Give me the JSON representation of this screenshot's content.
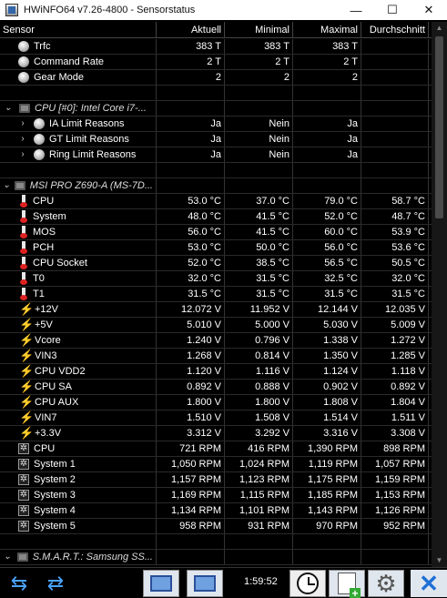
{
  "window": {
    "title": "HWiNFO64 v7.26-4800 - Sensorstatus",
    "minimize": "—",
    "maximize": "☐",
    "close": "✕"
  },
  "header": {
    "sensor": "Sensor",
    "current": "Aktuell",
    "min": "Minimal",
    "max": "Maximal",
    "avg": "Durchschnitt"
  },
  "rows": [
    {
      "type": "item",
      "icon": "circle-icon",
      "label": "Trfc",
      "cur": "383 T",
      "min": "383 T",
      "max": "383 T",
      "avg": ""
    },
    {
      "type": "item",
      "icon": "circle-icon",
      "label": "Command Rate",
      "cur": "2 T",
      "min": "2 T",
      "max": "2 T",
      "avg": ""
    },
    {
      "type": "item",
      "icon": "circle-icon",
      "label": "Gear Mode",
      "cur": "2",
      "min": "2",
      "max": "2",
      "avg": ""
    },
    {
      "type": "blank"
    },
    {
      "type": "group",
      "icon": "chip-icon",
      "label": "CPU [#0]: Intel Core i7-..."
    },
    {
      "type": "subgroup",
      "icon": "circle-icon",
      "label": "IA Limit Reasons",
      "cur": "Ja",
      "min": "Nein",
      "max": "Ja",
      "avg": ""
    },
    {
      "type": "subgroup",
      "icon": "circle-icon",
      "label": "GT Limit Reasons",
      "cur": "Ja",
      "min": "Nein",
      "max": "Ja",
      "avg": ""
    },
    {
      "type": "subgroup",
      "icon": "circle-icon",
      "label": "Ring Limit Reasons",
      "cur": "Ja",
      "min": "Nein",
      "max": "Ja",
      "avg": ""
    },
    {
      "type": "blank"
    },
    {
      "type": "group",
      "icon": "chip-icon",
      "label": "MSI PRO Z690-A (MS-7D..."
    },
    {
      "type": "item",
      "icon": "thermometer-icon",
      "label": "CPU",
      "cur": "53.0 °C",
      "min": "37.0 °C",
      "max": "79.0 °C",
      "avg": "58.7 °C"
    },
    {
      "type": "item",
      "icon": "thermometer-icon",
      "label": "System",
      "cur": "48.0 °C",
      "min": "41.5 °C",
      "max": "52.0 °C",
      "avg": "48.7 °C"
    },
    {
      "type": "item",
      "icon": "thermometer-icon",
      "label": "MOS",
      "cur": "56.0 °C",
      "min": "41.5 °C",
      "max": "60.0 °C",
      "avg": "53.9 °C"
    },
    {
      "type": "item",
      "icon": "thermometer-icon",
      "label": "PCH",
      "cur": "53.0 °C",
      "min": "50.0 °C",
      "max": "56.0 °C",
      "avg": "53.6 °C"
    },
    {
      "type": "item",
      "icon": "thermometer-icon",
      "label": "CPU Socket",
      "cur": "52.0 °C",
      "min": "38.5 °C",
      "max": "56.5 °C",
      "avg": "50.5 °C"
    },
    {
      "type": "item",
      "icon": "thermometer-icon",
      "label": "T0",
      "cur": "32.0 °C",
      "min": "31.5 °C",
      "max": "32.5 °C",
      "avg": "32.0 °C"
    },
    {
      "type": "item",
      "icon": "thermometer-icon",
      "label": "T1",
      "cur": "31.5 °C",
      "min": "31.5 °C",
      "max": "31.5 °C",
      "avg": "31.5 °C"
    },
    {
      "type": "item",
      "icon": "lightning-icon",
      "label": "+12V",
      "cur": "12.072 V",
      "min": "11.952 V",
      "max": "12.144 V",
      "avg": "12.035 V"
    },
    {
      "type": "item",
      "icon": "lightning-icon",
      "label": "+5V",
      "cur": "5.010 V",
      "min": "5.000 V",
      "max": "5.030 V",
      "avg": "5.009 V"
    },
    {
      "type": "item",
      "icon": "lightning-icon",
      "label": "Vcore",
      "cur": "1.240 V",
      "min": "0.796 V",
      "max": "1.338 V",
      "avg": "1.272 V"
    },
    {
      "type": "item",
      "icon": "lightning-icon",
      "label": "VIN3",
      "cur": "1.268 V",
      "min": "0.814 V",
      "max": "1.350 V",
      "avg": "1.285 V"
    },
    {
      "type": "item",
      "icon": "lightning-icon",
      "label": "CPU VDD2",
      "cur": "1.120 V",
      "min": "1.116 V",
      "max": "1.124 V",
      "avg": "1.118 V"
    },
    {
      "type": "item",
      "icon": "lightning-icon",
      "label": "CPU SA",
      "cur": "0.892 V",
      "min": "0.888 V",
      "max": "0.902 V",
      "avg": "0.892 V"
    },
    {
      "type": "item",
      "icon": "lightning-icon",
      "label": "CPU AUX",
      "cur": "1.800 V",
      "min": "1.800 V",
      "max": "1.808 V",
      "avg": "1.804 V"
    },
    {
      "type": "item",
      "icon": "lightning-icon",
      "label": "VIN7",
      "cur": "1.510 V",
      "min": "1.508 V",
      "max": "1.514 V",
      "avg": "1.511 V"
    },
    {
      "type": "item",
      "icon": "lightning-icon",
      "label": "+3.3V",
      "cur": "3.312 V",
      "min": "3.292 V",
      "max": "3.316 V",
      "avg": "3.308 V"
    },
    {
      "type": "item",
      "icon": "fan-icon",
      "label": "CPU",
      "cur": "721 RPM",
      "min": "416 RPM",
      "max": "1,390 RPM",
      "avg": "898 RPM"
    },
    {
      "type": "item",
      "icon": "fan-icon",
      "label": "System 1",
      "cur": "1,050 RPM",
      "min": "1,024 RPM",
      "max": "1,119 RPM",
      "avg": "1,057 RPM"
    },
    {
      "type": "item",
      "icon": "fan-icon",
      "label": "System 2",
      "cur": "1,157 RPM",
      "min": "1,123 RPM",
      "max": "1,175 RPM",
      "avg": "1,159 RPM"
    },
    {
      "type": "item",
      "icon": "fan-icon",
      "label": "System 3",
      "cur": "1,169 RPM",
      "min": "1,115 RPM",
      "max": "1,185 RPM",
      "avg": "1,153 RPM"
    },
    {
      "type": "item",
      "icon": "fan-icon",
      "label": "System 4",
      "cur": "1,134 RPM",
      "min": "1,101 RPM",
      "max": "1,143 RPM",
      "avg": "1,126 RPM"
    },
    {
      "type": "item",
      "icon": "fan-icon",
      "label": "System 5",
      "cur": "958 RPM",
      "min": "931 RPM",
      "max": "970 RPM",
      "avg": "952 RPM"
    },
    {
      "type": "blank"
    },
    {
      "type": "group",
      "icon": "chip-icon",
      "label": "S.M.A.R.T.: Samsung SS..."
    }
  ],
  "toolbar": {
    "elapsed_time": "1:59:52"
  },
  "colors": {
    "background": "#000000",
    "accent_arrow": "#4aa3ff",
    "bolt": "#ffcc00",
    "close_x": "#1f6fd6"
  }
}
